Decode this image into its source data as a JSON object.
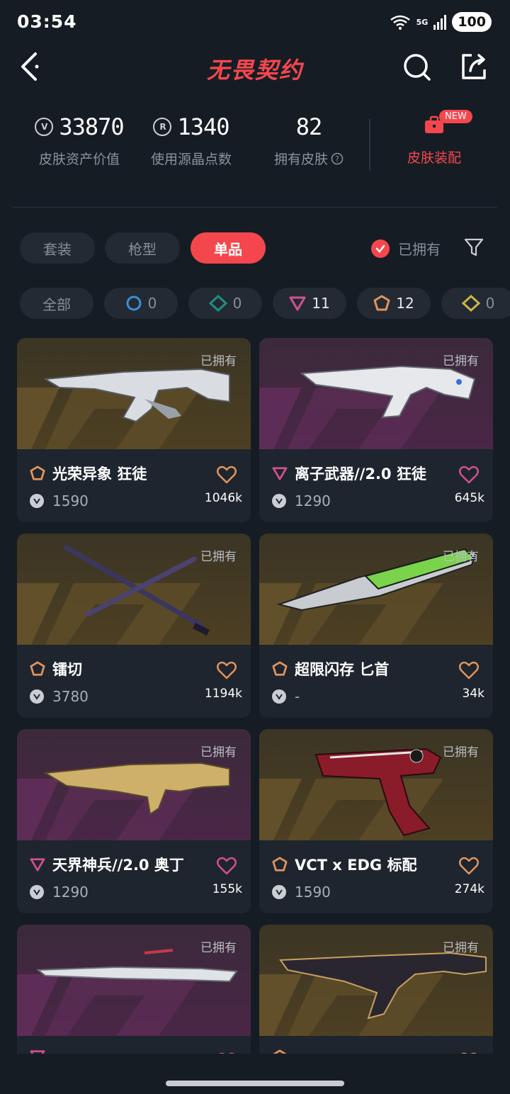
{
  "status": {
    "time": "03:54",
    "network": "5G",
    "battery": "100"
  },
  "nav": {
    "title": "无畏契约"
  },
  "stats": {
    "asset_value": "33870",
    "asset_value_label": "皮肤资产价值",
    "radianite": "1340",
    "radianite_label": "使用源晶点数",
    "owned_count": "82",
    "owned_count_label": "拥有皮肤",
    "equip_label": "皮肤装配",
    "new_badge": "NEW"
  },
  "tabs": [
    {
      "label": "套装"
    },
    {
      "label": "枪型"
    },
    {
      "label": "单品",
      "active": true
    }
  ],
  "owned_filter": {
    "label": "已拥有",
    "checked": true
  },
  "chips": [
    {
      "label": "全部"
    },
    {
      "label": "0",
      "tier": "select",
      "color": "#3b8fd6"
    },
    {
      "label": "0",
      "tier": "deluxe",
      "color": "#1e8f84"
    },
    {
      "label": "11",
      "tier": "premium",
      "color": "#d2508f"
    },
    {
      "label": "12",
      "tier": "exclusive",
      "color": "#e0945e"
    },
    {
      "label": "0",
      "tier": "ultra",
      "color": "#cdb44a"
    }
  ],
  "skins": [
    {
      "name": "光荣异象 狂徒",
      "price": "1590",
      "count": "1046k",
      "owned_label": "已拥有",
      "tier_color": "#e0945e",
      "bg": "brown"
    },
    {
      "name": "离子武器//2.0 狂徒",
      "price": "1290",
      "count": "645k",
      "owned_label": "已拥有",
      "tier_color": "#d2508f",
      "bg": "purple"
    },
    {
      "name": "镭切",
      "price": "3780",
      "count": "1194k",
      "owned_label": "已拥有",
      "tier_color": "#e0945e",
      "bg": "brown"
    },
    {
      "name": "超限闪存 匕首",
      "price": "-",
      "count": "34k",
      "owned_label": "已拥有",
      "tier_color": "#e0945e",
      "bg": "brown"
    },
    {
      "name": "天界神兵//2.0 奥丁",
      "price": "1290",
      "count": "155k",
      "owned_label": "已拥有",
      "tier_color": "#d2508f",
      "bg": "purple"
    },
    {
      "name": "VCT x EDG 标配",
      "price": "1590",
      "count": "274k",
      "owned_label": "已拥有",
      "tier_color": "#e0945e",
      "bg": "brown"
    },
    {
      "name": "",
      "price": "",
      "count": "",
      "owned_label": "已拥有",
      "tier_color": "#d2508f",
      "bg": "purple"
    },
    {
      "name": "",
      "price": "",
      "count": "",
      "owned_label": "已拥有",
      "tier_color": "#e0945e",
      "bg": "brown"
    }
  ],
  "colors": {
    "accent": "#f4474d",
    "background": "#161c24",
    "card": "#1e252e"
  }
}
